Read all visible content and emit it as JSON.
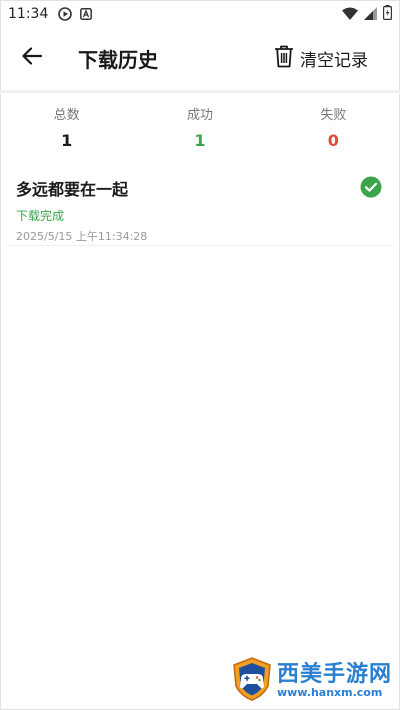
{
  "status_bar": {
    "time": "11:34",
    "icons": [
      "play-circle-icon",
      "notification-a-icon",
      "wifi-icon",
      "signal-icon",
      "battery-icon"
    ]
  },
  "app_bar": {
    "title": "下载历史",
    "clear_label": "清空记录",
    "icons": [
      "back-arrow-icon",
      "trash-icon"
    ]
  },
  "stats": {
    "total": {
      "label": "总数",
      "value": "1",
      "color": "#1a1a1a"
    },
    "success": {
      "label": "成功",
      "value": "1",
      "color": "#3aa54a"
    },
    "failed": {
      "label": "失败",
      "value": "0",
      "color": "#e14a3a"
    }
  },
  "history": [
    {
      "title": "多远都要在一起",
      "status": "下载完成",
      "status_color": "#3aa54a",
      "time": "2025/5/15 上午11:34:28",
      "icon": "check-circle-icon"
    }
  ],
  "watermark": {
    "name": "西美手游网",
    "url": "www.hanxm.com",
    "color": "#2a7fd0"
  }
}
